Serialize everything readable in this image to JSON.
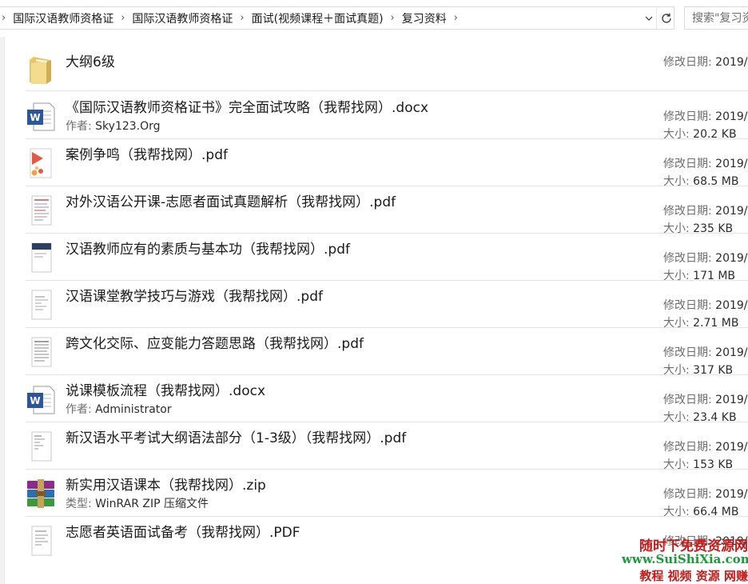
{
  "address_bar": {
    "breadcrumbs": [
      "国际汉语教师资格证",
      "国际汉语教师资格证",
      "面试(视频课程＋面试真题)",
      "复习资料"
    ],
    "search_placeholder": "搜索\"复习资料\""
  },
  "files": [
    {
      "name": "大纲6级",
      "icon": "folder-icon",
      "sub_label": "",
      "sub_value": "",
      "date_label": "修改日期:",
      "date": "2019/",
      "size_label": "",
      "size": ""
    },
    {
      "name": "《国际汉语教师资格证书》完全面试攻略（我帮找网）.docx",
      "icon": "word-doc-icon",
      "sub_label": "作者:",
      "sub_value": "Sky123.Org",
      "date_label": "修改日期:",
      "date": "2019/",
      "size_label": "大小:",
      "size": "20.2 KB"
    },
    {
      "name": "案例争鸣（我帮找网）.pdf",
      "icon": "pdf-thumbnail-icon",
      "sub_label": "",
      "sub_value": "",
      "date_label": "修改日期:",
      "date": "2019/",
      "size_label": "大小:",
      "size": "68.5 MB"
    },
    {
      "name": "对外汉语公开课-志愿者面试真题解析（我帮找网）.pdf",
      "icon": "pdf-thumbnail-icon",
      "sub_label": "",
      "sub_value": "",
      "date_label": "修改日期:",
      "date": "2019/",
      "size_label": "大小:",
      "size": "235 KB"
    },
    {
      "name": "汉语教师应有的素质与基本功（我帮找网）.pdf",
      "icon": "pdf-thumbnail-icon",
      "sub_label": "",
      "sub_value": "",
      "date_label": "修改日期:",
      "date": "2019/",
      "size_label": "大小:",
      "size": "171 MB"
    },
    {
      "name": "汉语课堂教学技巧与游戏（我帮找网）.pdf",
      "icon": "pdf-thumbnail-icon",
      "sub_label": "",
      "sub_value": "",
      "date_label": "修改日期:",
      "date": "2019/",
      "size_label": "大小:",
      "size": "2.71 MB"
    },
    {
      "name": "跨文化交际、应变能力答题思路（我帮找网）.pdf",
      "icon": "pdf-thumbnail-icon",
      "sub_label": "",
      "sub_value": "",
      "date_label": "修改日期:",
      "date": "2019/",
      "size_label": "大小:",
      "size": "317 KB"
    },
    {
      "name": "说课模板流程（我帮找网）.docx",
      "icon": "word-doc-icon",
      "sub_label": "作者:",
      "sub_value": "Administrator",
      "date_label": "修改日期:",
      "date": "2019/",
      "size_label": "大小:",
      "size": "23.4 KB"
    },
    {
      "name": "新汉语水平考试大纲语法部分（1-3级）（我帮找网）.pdf",
      "icon": "pdf-thumbnail-icon",
      "sub_label": "",
      "sub_value": "",
      "date_label": "修改日期:",
      "date": "2019/",
      "size_label": "大小:",
      "size": "153 KB"
    },
    {
      "name": "新实用汉语课本（我帮找网）.zip",
      "icon": "winrar-zip-icon",
      "sub_label": "类型:",
      "sub_value": "WinRAR ZIP 压缩文件",
      "date_label": "修改日期:",
      "date": "2019/",
      "size_label": "大小:",
      "size": "66.4 MB"
    },
    {
      "name": "志愿者英语面试备考（我帮找网）.PDF",
      "icon": "pdf-thumbnail-icon",
      "sub_label": "",
      "sub_value": "",
      "date_label": "修改日期:",
      "date": "2019/",
      "size_label": "",
      "size": ""
    }
  ],
  "watermark": {
    "line1": "随时下免费资源网",
    "line2": "www.SuiShiXia.com",
    "line3": "教程 视频 资源 网赚"
  },
  "colors": {
    "word_blue": "#2b579a",
    "label_gray": "#6d6d6d",
    "row_divider": "#e3e3e3",
    "watermark_red": "#c41b1b",
    "watermark_green": "#1a9a3a"
  }
}
